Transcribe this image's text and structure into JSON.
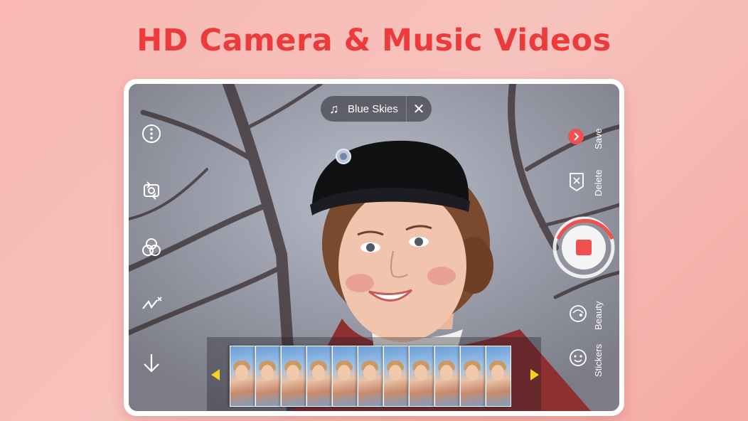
{
  "headline": "HD Camera & Music Videos",
  "music": {
    "song": "Blue Skies",
    "note_icon": "♫",
    "close_icon": "✕"
  },
  "right_controls": {
    "save_label": "Save",
    "delete_label": "Delete",
    "beauty_label": "Beauty",
    "stickers_label": "Stickers"
  },
  "left_controls": [
    "more-icon",
    "switch-camera-icon",
    "filters-icon",
    "flash-off-icon",
    "download-icon"
  ],
  "filmstrip": {
    "frame_count": 11
  },
  "colors": {
    "accent": "#ec3b3b",
    "record_red": "#f0504e",
    "arrow_yellow": "#f5d21d",
    "background": "#f7c2bd"
  }
}
